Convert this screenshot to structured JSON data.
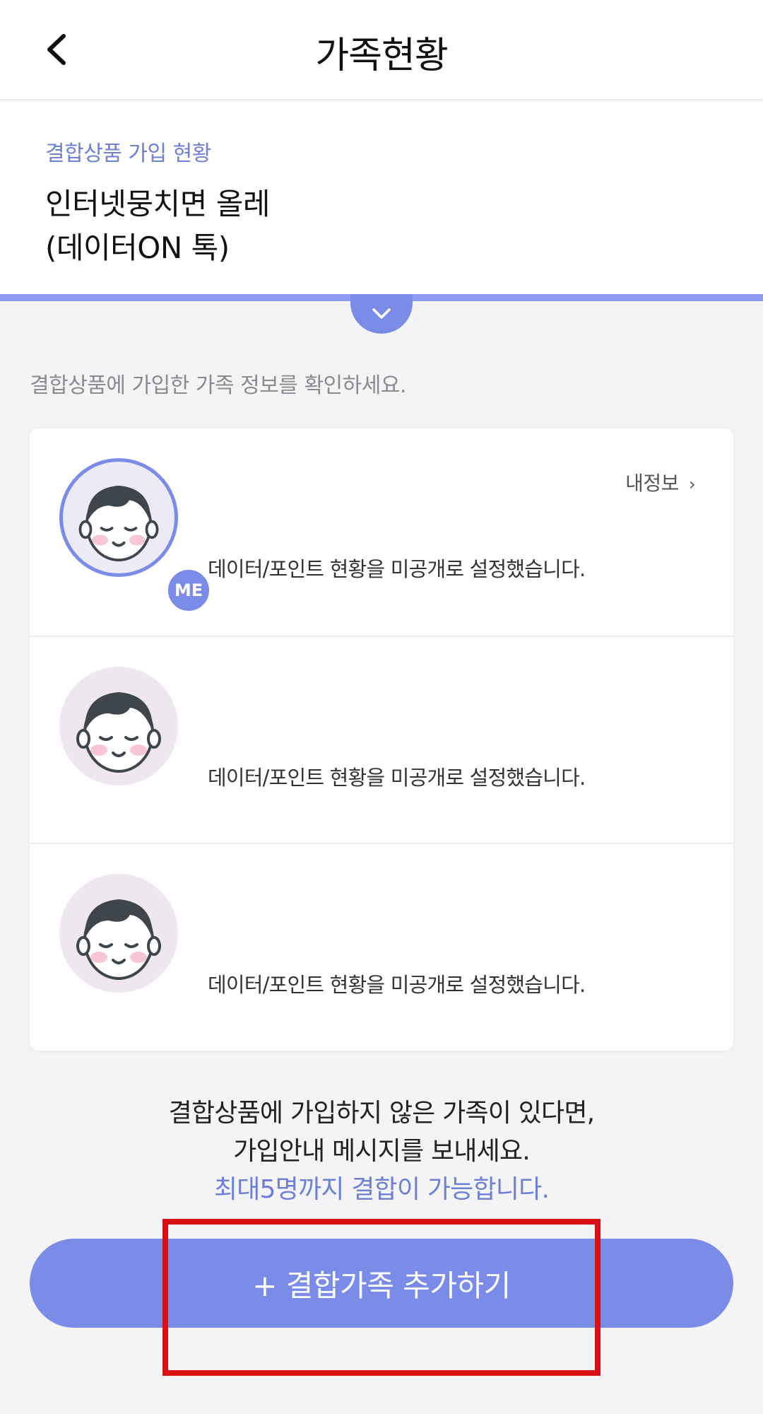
{
  "header": {
    "title": "가족현황",
    "back_icon": "chevron-left-icon"
  },
  "summary": {
    "label": "결합상품 가입 현황",
    "product_name": "인터넷뭉치면 올레\n(데이터ON 톡)",
    "toggle_icon": "chevron-down-icon"
  },
  "intro_text": "결합상품에 가입한 가족 정보를 확인하세요.",
  "members": [
    {
      "is_me": true,
      "badge": "ME",
      "link_label": "내정보",
      "link_icon": "chevron-right-icon",
      "status": "데이터/포인트 현황을 미공개로 설정했습니다."
    },
    {
      "is_me": false,
      "status": "데이터/포인트 현황을 미공개로 설정했습니다."
    },
    {
      "is_me": false,
      "status": "데이터/포인트 현황을 미공개로 설정했습니다."
    }
  ],
  "notice": {
    "line1": "결합상품에 가입하지 않은 가족이 있다면,",
    "line2": "가입안내 메시지를 보내세요.",
    "limit": "최대5명까지 결합이 가능합니다."
  },
  "add_button_label": "+ 결합가족 추가하기",
  "colors": {
    "accent": "#7b8be8",
    "accent_text": "#6d7fd6",
    "highlight": "#d80f14",
    "background": "#f4f4f6"
  }
}
